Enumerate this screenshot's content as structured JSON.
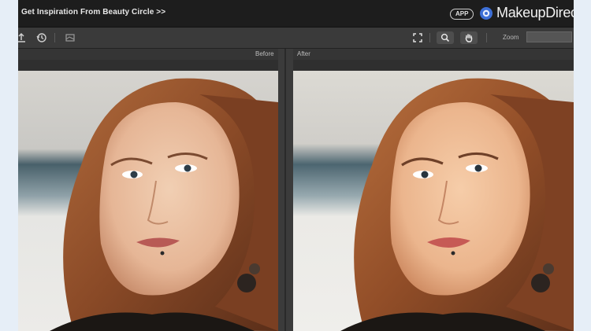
{
  "header": {
    "inspiration_link": "Get Inspiration From Beauty Circle >>",
    "app_badge": "APP",
    "brand_name": "MakeupDirec"
  },
  "toolbar": {
    "zoom_label": "Zoom",
    "zoom_value": ""
  },
  "compare": {
    "before_label": "Before",
    "after_label": "After"
  },
  "colors": {
    "titlebar": "#1d1d1d",
    "toolbar": "#3a3a3a",
    "panel": "#2b2b2b",
    "skin_before": "#e9c1a3",
    "skin_after": "#f0c19c",
    "hair": "#a0582f"
  }
}
